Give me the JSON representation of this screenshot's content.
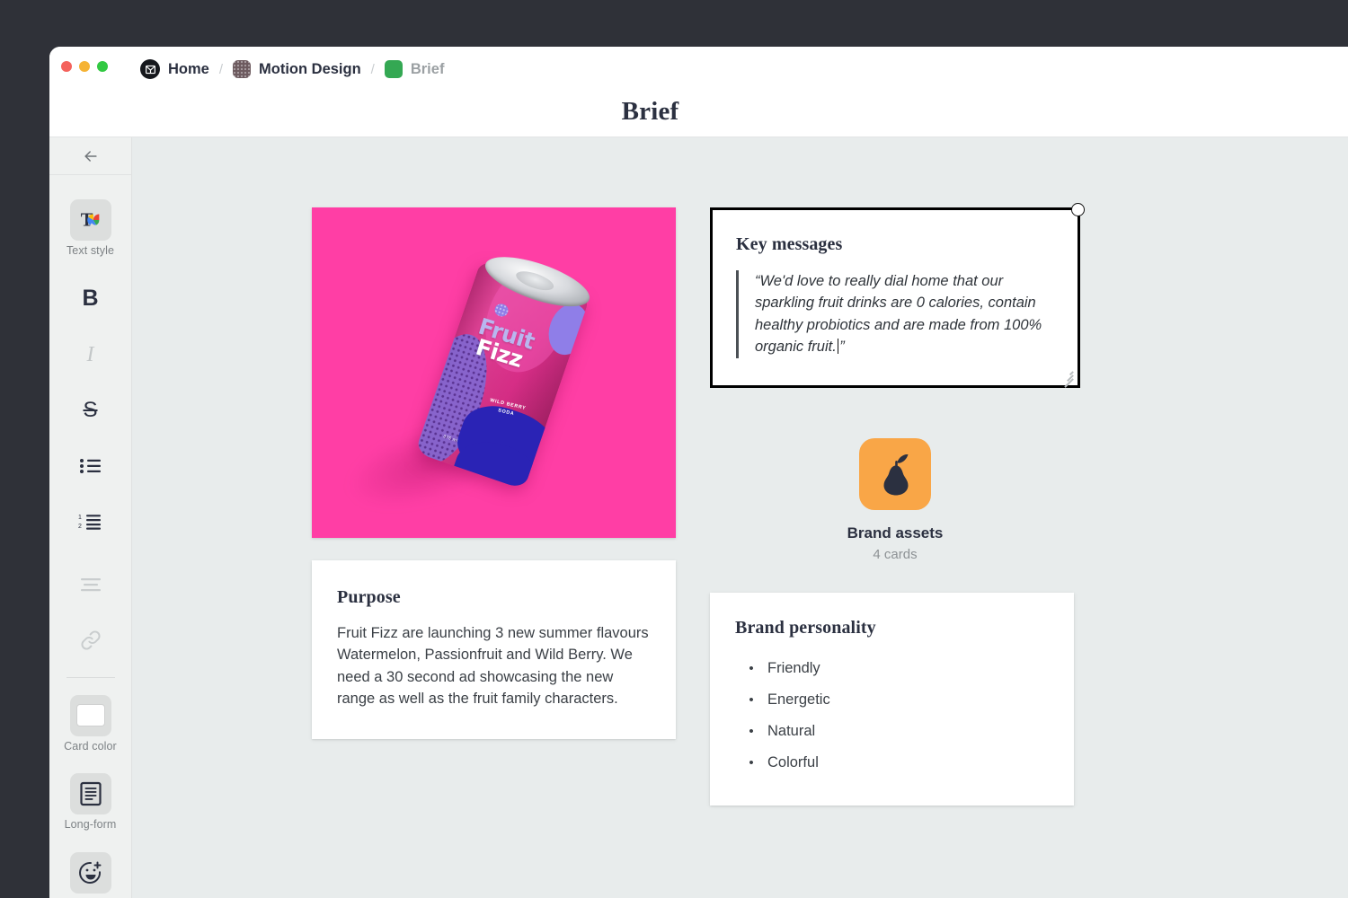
{
  "window": {
    "traffic_lights": [
      "close",
      "minimize",
      "maximize"
    ],
    "breadcrumb": [
      {
        "label": "Home",
        "icon": "home-logo-icon"
      },
      {
        "label": "Motion Design",
        "icon": "motion-design-folder-icon"
      },
      {
        "label": "Brief",
        "icon": "brief-folder-icon"
      }
    ],
    "separator": "/",
    "doc_title": "Brief"
  },
  "sidebar": {
    "back_arrow": "←",
    "tools": [
      {
        "name": "text-style",
        "label": "Text style",
        "glyph": "T",
        "active": true,
        "dim": false
      },
      {
        "name": "bold",
        "label": "",
        "glyph": "B",
        "active": false,
        "dim": false
      },
      {
        "name": "italic",
        "label": "",
        "glyph": "I",
        "active": false,
        "dim": true
      },
      {
        "name": "strikethrough",
        "label": "",
        "glyph": "S",
        "active": false,
        "dim": false
      },
      {
        "name": "bulleted-list",
        "label": "",
        "glyph": "",
        "active": false,
        "dim": false
      },
      {
        "name": "numbered-list",
        "label": "",
        "glyph": "",
        "active": false,
        "dim": false
      },
      {
        "name": "align",
        "label": "",
        "glyph": "",
        "active": false,
        "dim": true
      },
      {
        "name": "link",
        "label": "",
        "glyph": "",
        "active": false,
        "dim": true
      },
      {
        "name": "card-color",
        "label": "Card color",
        "glyph": "",
        "active": true,
        "dim": false
      },
      {
        "name": "long-form",
        "label": "Long-form",
        "glyph": "",
        "active": true,
        "dim": false
      },
      {
        "name": "add-reaction",
        "label": "",
        "glyph": "",
        "active": true,
        "dim": false
      }
    ]
  },
  "canvas": {
    "image_card": {
      "alt": "Fruit Fizz soda can on pink background",
      "brand_line1": "Fruit",
      "brand_line2": "Fizz",
      "flavour_line1": "WILD BERRY",
      "flavour_line2": "SODA",
      "volume": "375 ml",
      "background_color": "#ff3ea5"
    },
    "purpose_card": {
      "heading": "Purpose",
      "body": "Fruit Fizz are launching 3 new summer flavours Watermelon, Passionfruit and Wild Berry. We need a 30 second ad showcasing the new range as well as the fruit family characters."
    },
    "key_messages_card": {
      "heading": "Key messages",
      "quote": "“We'd love to really dial home that our sparkling fruit drinks are 0 calories, contain healthy probiotics and are made from 100% organic fruit.",
      "quote_end": "”",
      "selected": true
    },
    "brand_assets_folder": {
      "name": "Brand assets",
      "count": "4 cards",
      "icon": "pear-icon",
      "icon_background": "#f9a647"
    },
    "brand_personality_card": {
      "heading": "Brand personality",
      "items": [
        "Friendly",
        "Energetic",
        "Natural",
        "Colorful"
      ]
    }
  },
  "colors": {
    "desktop": "#2f3138",
    "canvas": "#e8ecec",
    "sidebar": "#eff1f0",
    "text_dark": "#2b3040",
    "accent_pink": "#ff3ea5",
    "accent_orange": "#f9a647",
    "folder_green": "#34a853"
  }
}
